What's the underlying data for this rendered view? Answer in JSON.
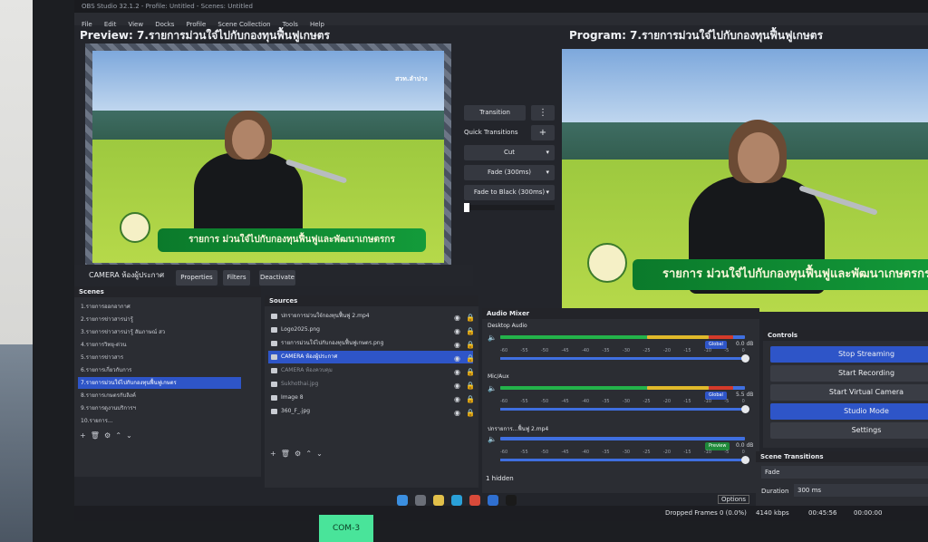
{
  "window": {
    "title": "OBS Studio 32.1.2 - Profile: Untitled - Scenes: Untitled"
  },
  "menu": [
    "File",
    "Edit",
    "View",
    "Docks",
    "Profile",
    "Scene Collection",
    "Tools",
    "Help"
  ],
  "preview": {
    "title": "Preview: 7.รายการม่วนใจ๋ไปกับกองทุนฟื้นฟูเกษตร"
  },
  "program": {
    "title": "Program: 7.รายการม่วนใจ๋ไปกับกองทุนฟื้นฟูเกษตร"
  },
  "overlay": {
    "banner": "รายการ ม่วนใจ๋ไปกับกองทุนฟื้นฟูและพัฒนาเกษตรกร",
    "station": "สวท.ลำปาง"
  },
  "source_toolbar": {
    "selected": "CAMERA ห้องผู้ประกาศ",
    "properties": "Properties",
    "filters": "Filters",
    "deactivate": "Deactivate"
  },
  "transitions": {
    "transition": "Transition",
    "quick": "Quick Transitions",
    "cut": "Cut",
    "fade300": "Fade (300ms)",
    "fade_black": "Fade to Black (300ms)"
  },
  "scenes": {
    "title": "Scenes",
    "items": [
      "1.รายการออกอากาศ",
      "2.รายการข่าวสารน่ารู้",
      "3.รายการข่าวสารน่ารู้ สัมภาษณ์ สว",
      "4.รายการวิทยุ-ด่วน",
      "5.รายการข่าวสาร",
      "6.รายการเกี่ยวกับการ",
      "7.รายการม่วนใจ๋ไปกับกองทุนฟื้นฟูเกษตร",
      "8.รายการเกษตรกับลิงค์",
      "9.รายการดูงานบริการฯ",
      "10.รายการ..."
    ],
    "selected_index": 6
  },
  "sources": {
    "title": "Sources",
    "items": [
      {
        "name": "ปกรายการม่วนใจ๋กองทุนฟื้นฟู 2.mp4",
        "type": "media",
        "dim": false
      },
      {
        "name": "Logo2025.png",
        "type": "image",
        "dim": false
      },
      {
        "name": "รายการม่วนใจ๋ไปกับกองทุนฟื้นฟูเกษตร.png",
        "type": "image",
        "dim": false
      },
      {
        "name": "CAMERA ห้องผู้ประกาศ",
        "type": "camera",
        "dim": false
      },
      {
        "name": "CAMERA ห้องควบคุม",
        "type": "camera",
        "dim": true
      },
      {
        "name": "Sukhothai.jpg",
        "type": "image",
        "dim": true
      },
      {
        "name": "Image 8",
        "type": "image",
        "dim": false
      },
      {
        "name": "360_F_.jpg",
        "type": "image",
        "dim": false
      }
    ],
    "selected_index": 3,
    "hidden": "1 hidden"
  },
  "mixer": {
    "title": "Audio Mixer",
    "channels": [
      {
        "name": "Desktop Audio",
        "db": "0.0 dB",
        "badge": "Global"
      },
      {
        "name": "Mic/Aux",
        "db": "5.5 dB",
        "badge": "Global"
      },
      {
        "name": "ปกรายการ...ฟื้นฟู 2.mp4",
        "db": "0.0 dB",
        "badge": "Preview"
      }
    ],
    "scale": [
      "-60",
      "-55",
      "-50",
      "-45",
      "-40",
      "-35",
      "-30",
      "-25",
      "-20",
      "-15",
      "-10",
      "-5",
      "0"
    ]
  },
  "controls": {
    "title": "Controls",
    "buttons": [
      "Stop Streaming",
      "Start Recording",
      "Start Virtual Camera",
      "Studio Mode",
      "Settings"
    ]
  },
  "scene_transitions": {
    "title": "Scene Transitions",
    "type": "Fade",
    "duration_label": "Duration",
    "duration": "300 ms"
  },
  "status": {
    "dropped": "Dropped Frames 0 (0.0%)",
    "bitrate": "4140 kbps",
    "time": "00:45:56",
    "rec_time": "00:00:00",
    "options": "Options"
  },
  "label": {
    "com": "COM-3"
  },
  "colors": {
    "accent": "#2e55c8",
    "meter_green": "#23b34a",
    "meter_yellow": "#e0b92a",
    "meter_red": "#d43a2a"
  }
}
